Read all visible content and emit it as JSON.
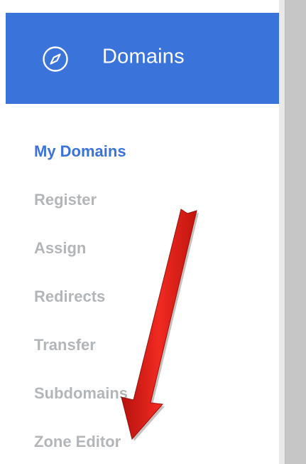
{
  "sidebar": {
    "header": {
      "title": "Domains",
      "icon": "compass-icon",
      "background_color": "#3a73d9"
    },
    "items": [
      {
        "label": "My Domains",
        "active": true
      },
      {
        "label": "Register",
        "active": false
      },
      {
        "label": "Assign",
        "active": false
      },
      {
        "label": "Redirects",
        "active": false
      },
      {
        "label": "Transfer",
        "active": false
      },
      {
        "label": "Subdomains",
        "active": false
      },
      {
        "label": "Zone Editor",
        "active": false
      }
    ],
    "active_color": "#3a73d9",
    "inactive_color": "#b3b6b9"
  },
  "annotation": {
    "type": "red-arrow",
    "color": "#e8221b",
    "points_to": "Zone Editor"
  }
}
